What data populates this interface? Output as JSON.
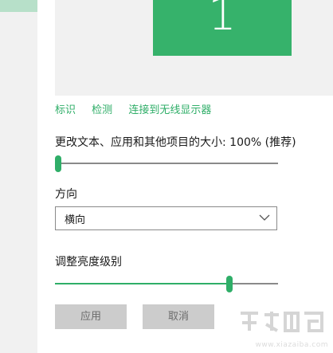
{
  "preview": {
    "monitor_number": "1"
  },
  "links": {
    "identify": "标识",
    "detect": "检测",
    "connect_wireless": "连接到无线显示器"
  },
  "scale": {
    "label": "更改文本、应用和其他项目的大小: 100% (推荐)",
    "value_fraction": 0.0
  },
  "orientation": {
    "label": "方向",
    "selected": "横向"
  },
  "brightness": {
    "label": "调整亮度级别",
    "value_fraction": 0.79
  },
  "buttons": {
    "apply": "应用",
    "cancel": "取消"
  },
  "watermark": {
    "text": "www.xiazaiba.com"
  },
  "colors": {
    "accent": "#2fae68",
    "monitor": "#36b26b",
    "button_bg": "#cccccc"
  }
}
